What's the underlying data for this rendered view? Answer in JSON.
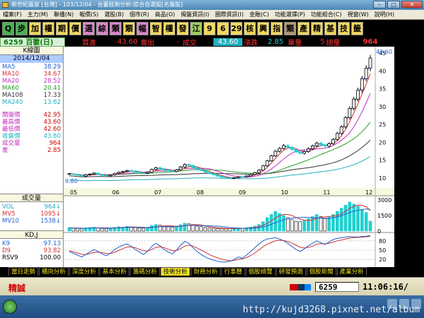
{
  "window": {
    "title": "新世紀贏家 [台灣] - 103/12/04 - 台蕃技術分析:綜合自選股[名盤股]"
  },
  "menu": [
    "檔案(F)",
    "主力(M)",
    "聯播(N)",
    "報價(S)",
    "選股(B)",
    "個市(R)",
    "商品(O)",
    "揭盤資訊(I)",
    "國際資訊(I)",
    "金融(C)",
    "功能選擇(P)",
    "功能組合(C)",
    "視窗(W)",
    "說明(H)"
  ],
  "toolbar": [
    {
      "label": "Q",
      "color": "green",
      "icon": "search-icon"
    },
    {
      "label": "步",
      "color": "green"
    },
    {
      "label": "加",
      "color": "yellow"
    },
    {
      "label": "權",
      "color": "yellow"
    },
    {
      "label": "期",
      "color": "yellow"
    },
    {
      "label": "價",
      "color": "yellow"
    },
    {
      "label": "選",
      "color": "pink"
    },
    {
      "label": "綜",
      "color": "pink"
    },
    {
      "label": "類",
      "color": "pink"
    },
    {
      "label": "類",
      "color": "yellow"
    },
    {
      "label": "幅",
      "color": "pink"
    },
    {
      "label": "智",
      "color": "yellow"
    },
    {
      "label": "權",
      "color": "yellow"
    },
    {
      "label": "發",
      "color": "yellow"
    },
    {
      "label": "江",
      "color": "lgreen"
    },
    {
      "label": "9",
      "color": "yellow"
    },
    {
      "label": "6",
      "color": "yellow"
    },
    {
      "label": "29",
      "color": "yellow"
    },
    {
      "label": "核",
      "color": "yellow"
    },
    {
      "label": "興",
      "color": "yellow"
    },
    {
      "label": "指",
      "color": "yellow"
    },
    {
      "label": "類",
      "color": "brown"
    },
    {
      "label": "產",
      "color": "yellow"
    },
    {
      "label": "精",
      "color": "yellow"
    },
    {
      "label": "基",
      "color": "yellow"
    },
    {
      "label": "技",
      "color": "yellow"
    },
    {
      "label": "籤",
      "color": "yellow"
    }
  ],
  "info": {
    "code": "6259 百徽(日)",
    "buy_label": "買進",
    "buy": "43.60",
    "sell_label": "賣出",
    "sell": "-",
    "trade_label": "成交",
    "trade": "43.60",
    "change_label": "漲跌",
    "change": "2.85",
    "unit_label": "單量",
    "unit": "5",
    "total_label": "總量",
    "total": "964"
  },
  "left": {
    "header": "K線圖",
    "date": "2014/12/04",
    "ma": [
      {
        "name": "MA5",
        "value": "38.29",
        "color": "#1f5fd0"
      },
      {
        "name": "MA10",
        "value": "34.67",
        "color": "#d03030"
      },
      {
        "name": "MA20",
        "value": "28.52",
        "color": "#c030c0"
      },
      {
        "name": "MA60",
        "value": "20.41",
        "color": "#2aa02a"
      },
      {
        "name": "MA108",
        "value": "17.33",
        "color": "#333333"
      },
      {
        "name": "MA240",
        "value": "13.62",
        "color": "#20b0c0"
      }
    ],
    "quotes": [
      {
        "name": "開盤價",
        "value": "42.95"
      },
      {
        "name": "最高價",
        "value": "43.60"
      },
      {
        "name": "最低價",
        "value": "42.60"
      },
      {
        "name": "收盤價",
        "value": "43.60",
        "color": "#20b0c0"
      },
      {
        "name": "成交量",
        "value": "964"
      },
      {
        "name": "差",
        "value": "2.85"
      }
    ],
    "vol_header": "成交量",
    "vol": [
      {
        "name": "VOL",
        "value": "964↓",
        "color": "#20b0c0"
      },
      {
        "name": "MV5",
        "value": "1095↓",
        "color": "#d03030"
      },
      {
        "name": "MV10",
        "value": "1538↓",
        "color": "#1f5fd0"
      }
    ],
    "kd_header": "KD,J",
    "kd": [
      {
        "name": "K9",
        "value": "97.13",
        "color": "#1f5fd0"
      },
      {
        "name": "D9",
        "value": "93.82",
        "color": "#d03030"
      },
      {
        "name": "RSV9",
        "value": "100.00",
        "color": "#000000"
      }
    ]
  },
  "chart_data": {
    "type": "line",
    "months": [
      "05",
      "06",
      "07",
      "08",
      "09",
      "10",
      "11",
      "12"
    ],
    "price_ticks": [
      10,
      15,
      20,
      25,
      30,
      35,
      40,
      45
    ],
    "price_last": "43.60",
    "price_low_label": "9.60",
    "vol_ticks": [
      "3000",
      "1500",
      "0"
    ],
    "kd_ticks": [
      "80",
      "50",
      "20"
    ],
    "close": [
      11.2,
      11.0,
      10.8,
      10.5,
      10.9,
      11.1,
      11.4,
      11.0,
      10.7,
      10.6,
      10.9,
      11.3,
      11.6,
      11.8,
      12.1,
      12.0,
      11.7,
      11.5,
      11.3,
      11.6,
      12.4,
      12.9,
      12.6,
      12.2,
      12.0,
      11.8,
      12.3,
      13.1,
      13.8,
      13.5,
      12.9,
      12.4,
      12.1,
      11.6,
      11.2,
      10.9,
      10.5,
      10.2,
      10.0,
      9.9,
      10.1,
      10.4,
      10.3,
      10.6,
      11.0,
      11.5,
      12.2,
      13.4,
      14.8,
      16.2,
      17.5,
      18.3,
      19.1,
      18.6,
      18.0,
      17.3,
      16.9,
      17.4,
      18.2,
      19.0,
      19.8,
      19.3,
      18.9,
      19.6,
      20.8,
      22.5,
      24.3,
      26.9,
      29.5,
      32.1,
      34.6,
      37.8,
      40.75,
      43.6
    ],
    "volume": [
      320,
      280,
      260,
      240,
      300,
      340,
      380,
      300,
      260,
      250,
      300,
      360,
      420,
      380,
      460,
      400,
      330,
      300,
      280,
      320,
      520,
      640,
      560,
      460,
      400,
      380,
      480,
      620,
      760,
      700,
      560,
      480,
      420,
      360,
      300,
      280,
      260,
      240,
      220,
      240,
      260,
      300,
      280,
      340,
      400,
      480,
      640,
      900,
      1300,
      1600,
      1900,
      1700,
      1500,
      1300,
      1100,
      950,
      900,
      1000,
      1200,
      1400,
      1600,
      1400,
      1250,
      1350,
      1600,
      1900,
      2200,
      2500,
      2800,
      2600,
      2400,
      2100,
      1800,
      964
    ],
    "k": [
      45,
      40,
      34,
      28,
      36,
      44,
      52,
      46,
      38,
      32,
      40,
      52,
      60,
      66,
      70,
      62,
      52,
      44,
      36,
      46,
      62,
      72,
      64,
      52,
      44,
      38,
      50,
      66,
      78,
      72,
      58,
      46,
      36,
      28,
      22,
      18,
      14,
      12,
      12,
      14,
      20,
      28,
      24,
      34,
      46,
      58,
      70,
      80,
      86,
      88,
      90,
      86,
      80,
      72,
      62,
      52,
      46,
      54,
      64,
      72,
      80,
      74,
      68,
      76,
      84,
      88,
      90,
      92,
      94,
      93,
      92,
      94,
      95,
      97.13
    ],
    "d": [
      48,
      45,
      41,
      37,
      36,
      39,
      43,
      44,
      42,
      39,
      39,
      43,
      49,
      55,
      60,
      61,
      58,
      53,
      48,
      47,
      52,
      59,
      61,
      58,
      53,
      48,
      49,
      55,
      63,
      66,
      63,
      57,
      50,
      43,
      36,
      30,
      25,
      21,
      18,
      16,
      17,
      21,
      22,
      26,
      33,
      41,
      51,
      61,
      69,
      75,
      80,
      82,
      81,
      78,
      73,
      66,
      59,
      57,
      59,
      63,
      69,
      71,
      70,
      72,
      76,
      80,
      83,
      86,
      89,
      90,
      91,
      92,
      93,
      93.82
    ]
  },
  "tabs": [
    "當日走勢",
    "橫向分析",
    "深度分析",
    "基本分析",
    "籌碼分析",
    "技術分析",
    "財務分析",
    "行事曆",
    "個股總覽",
    "研發預測",
    "個股新聞",
    "產業分析"
  ],
  "active_tab": 5,
  "status": {
    "brand": "精誠",
    "stock": "6259",
    "time": "11:06:16/"
  },
  "watermark": "http://kujd3268.pixnet.net/album",
  "colors": {
    "up": "#ff3030",
    "down": "#20d0d0",
    "ma5": "#1f5fd0",
    "ma10": "#d03030",
    "ma20": "#c030c0",
    "ma60": "#2aa02a",
    "ma108": "#333333",
    "ma240": "#20b0c0"
  }
}
